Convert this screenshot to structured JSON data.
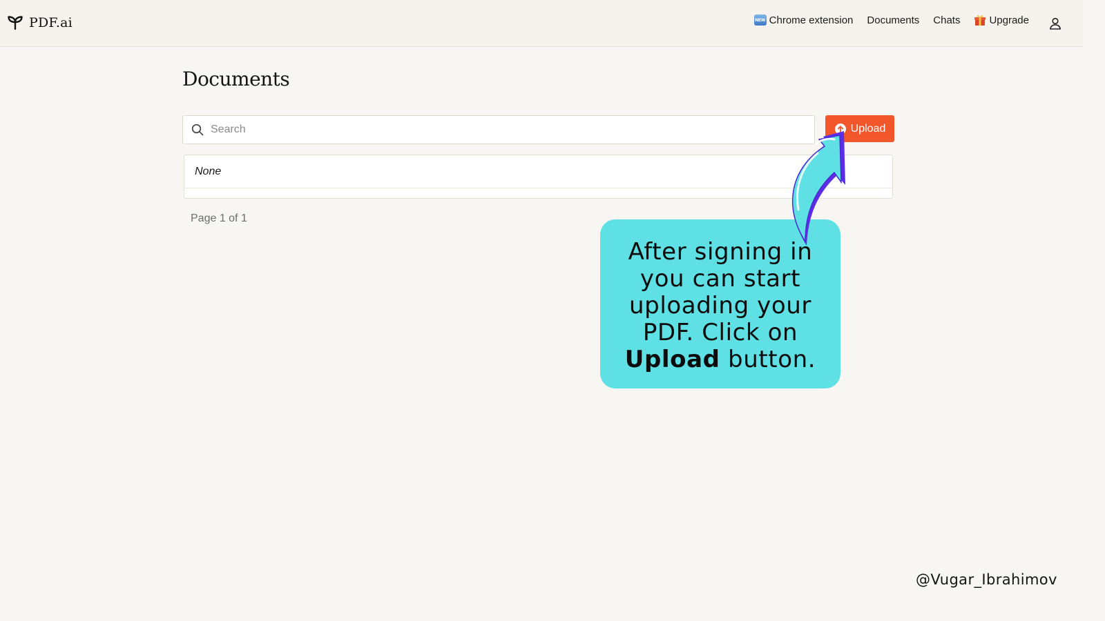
{
  "header": {
    "brand": "PDF.ai",
    "nav": {
      "chrome_extension": {
        "badge": "NEW",
        "label": "Chrome extension"
      },
      "documents": "Documents",
      "chats": "Chats",
      "upgrade": "Upgrade"
    },
    "icons": {
      "logo": "sprout-logo-icon",
      "new_badge": "new-badge-icon",
      "upgrade": "gift-icon",
      "account": "user-icon"
    }
  },
  "main": {
    "title": "Documents",
    "search": {
      "placeholder": "Search",
      "value": "",
      "icon": "search-icon"
    },
    "upload_button": {
      "label": "Upload",
      "icon": "upload-circle-icon"
    },
    "documents": [
      {
        "label": "None"
      }
    ],
    "pagination": "Page 1 of 1"
  },
  "annotation": {
    "text_before": "After signing in you can start uploading your PDF. Click on",
    "text_bold": "Upload",
    "text_after": "button.",
    "arrow_icon": "curved-arrow-icon"
  },
  "watermark": "@Vugar_Ibrahimov",
  "colors": {
    "accent": "#f2562b",
    "callout_bg": "#5ee0e4",
    "arrow_fill": "#5ee0e4",
    "arrow_shadow": "#5b2ee6",
    "page_bg": "#f8f6f2"
  }
}
